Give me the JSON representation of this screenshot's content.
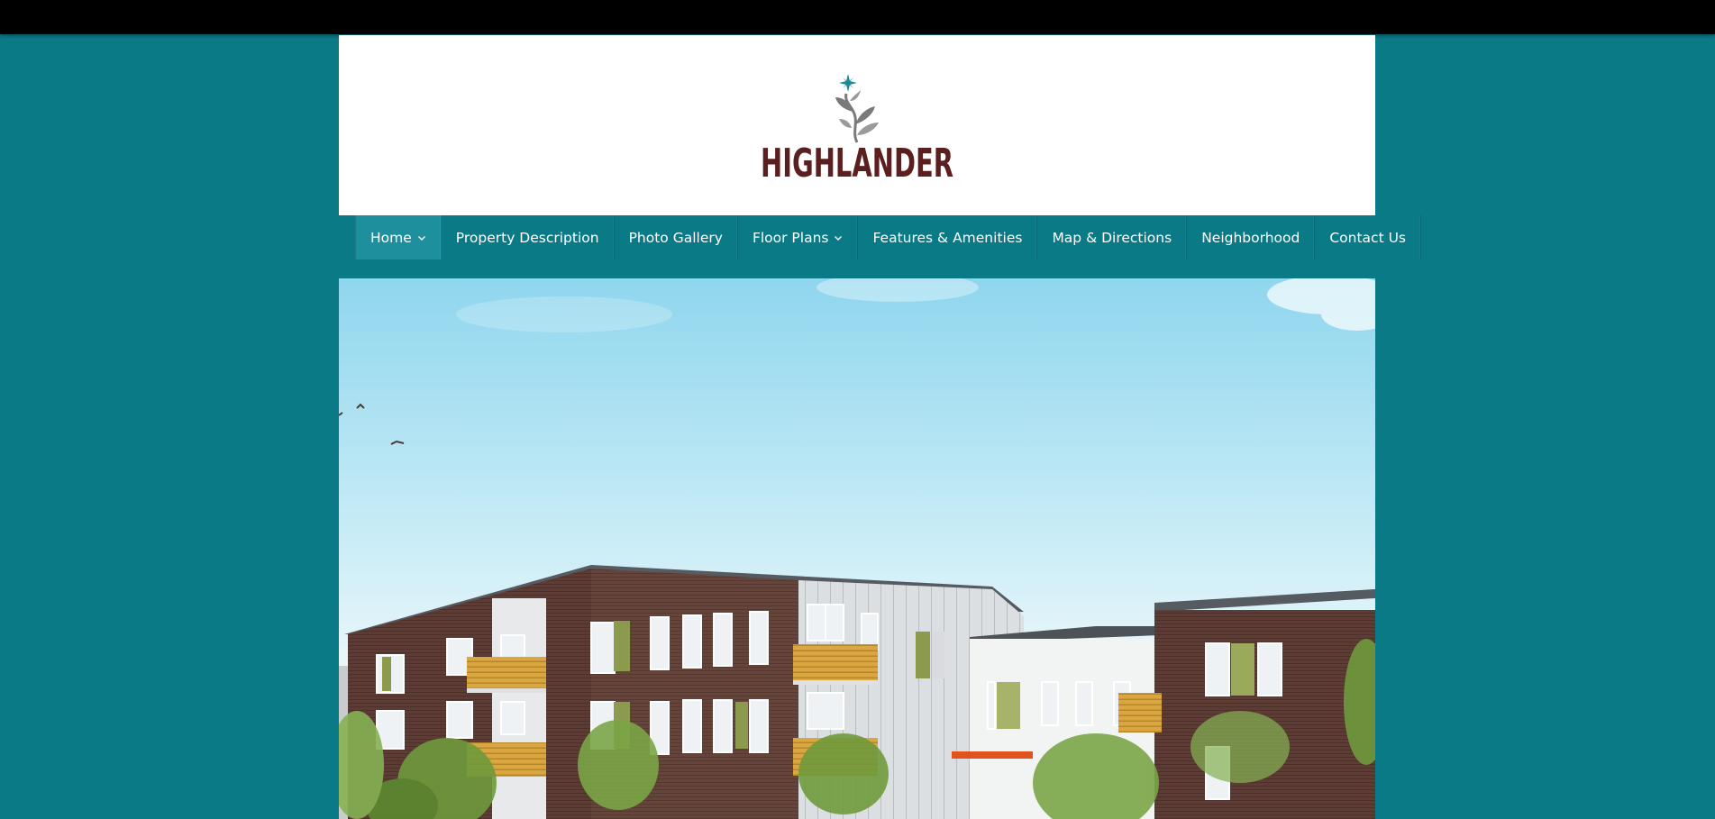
{
  "site": {
    "logo_text": "HIGHLANDER",
    "logo_icon": "flower-sprig-icon"
  },
  "nav": {
    "items": [
      {
        "label": "Home",
        "active": true,
        "has_dropdown": true
      },
      {
        "label": "Property Description",
        "active": false,
        "has_dropdown": false
      },
      {
        "label": "Photo Gallery",
        "active": false,
        "has_dropdown": false
      },
      {
        "label": "Floor Plans",
        "active": false,
        "has_dropdown": true
      },
      {
        "label": "Features & Amenities",
        "active": false,
        "has_dropdown": false
      },
      {
        "label": "Map & Directions",
        "active": false,
        "has_dropdown": false
      },
      {
        "label": "Neighborhood",
        "active": false,
        "has_dropdown": false
      },
      {
        "label": "Contact Us",
        "active": false,
        "has_dropdown": false
      }
    ]
  },
  "hero": {
    "image": "apartment-building-rendering"
  },
  "colors": {
    "page_bg": "#0a7a87",
    "nav_active": "#1e8f9c",
    "logo_text": "#5b1f1f",
    "logo_star": "#1a8a98",
    "top_bar": "#000000"
  }
}
